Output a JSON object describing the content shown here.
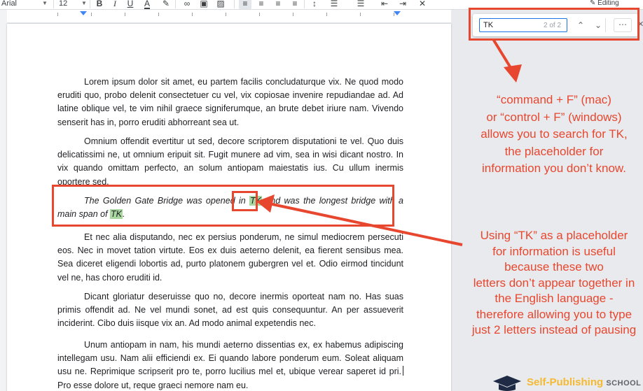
{
  "toolbar": {
    "font": "Arial",
    "font_size": "12",
    "mode": "Editing"
  },
  "find": {
    "query": "TK",
    "count": "2 of 2",
    "prev": "⌃",
    "next": "⌄",
    "more": "⋯"
  },
  "document": {
    "paragraphs": [
      "Lorem ipsum dolor sit amet, eu partem facilis concludaturque vix. Ne quod modo eruditi quo, probo delenit consectetuer cu vel, vix copiosae invenire repudiandae ad. Ad latine oblique vel, te vim nihil graece signiferumque, an brute debet iriure nam. Vivendo senserit has in, porro eruditi abhorreant sea ut.",
      "Omnium offendit evertitur ut sed, decore scriptorem disputationi te vel. Quo duis delicatissimi ne, ut omnium eripuit sit. Fugit munere ad vim, sea in wisi dicant nostro. In vix quando omittam perfecto, an solum antiopam maiestatis ius. Cu ullum inermis oportere sed.",
      "Et nec alia disputando, nec ex persius ponderum, ne simul mediocrem persecuti eos. Nec in movet tation virtute. Eos ex duis aeterno delenit, ea fierent sensibus mea. Sea diceret eligendi lobortis ad, purto platonem gubergren vel et. Odio eirmod tincidunt vel ne, has choro eruditi id.",
      "Dicant gloriatur deseruisse quo no, decore inermis oporteat nam no. Has suas primis offendit ad. Ne vel mundi sonet, ad est quis consequuntur. An per assueverit inciderint. Cibo duis iisque vix an. Ad modo animal expetendis nec.",
      "Unum antiopam in nam, his mundi aeterno dissentias ex, ex habemus adipiscing intellegam usu. Nam alii efficiendi ex. Ei quando labore ponderum eum. Soleat aliquam usu ne. Reprimique scripserit pro te, porro lucilius mel et, ubique verear saperet id pri.",
      "Pro esse dolore ut, reque graeci nemore nam eu."
    ],
    "highlight_sentence": {
      "part1": "The Golden Gate Bridge was opened in ",
      "match1": "TK",
      "part2": " and was the longest bridge with a main span of ",
      "match2": "TK",
      "part3": "."
    }
  },
  "annotations": {
    "callout1": "“command + F” (mac)\nor “control + F” (windows)\nallows you to search for TK,\nthe placeholder for\ninformation you don’t know.",
    "callout2": "Using “TK” as a placeholder\nfor information is useful\nbecause these two\nletters don’t appear together in\nthe English language -\ntherefore allowing you to type\njust 2 letters instead of pausing",
    "accent_color": "#e8472f"
  },
  "logo": {
    "name": "Self-Publishing",
    "suffix": "SCHOOL",
    "color": "#f5b932"
  }
}
